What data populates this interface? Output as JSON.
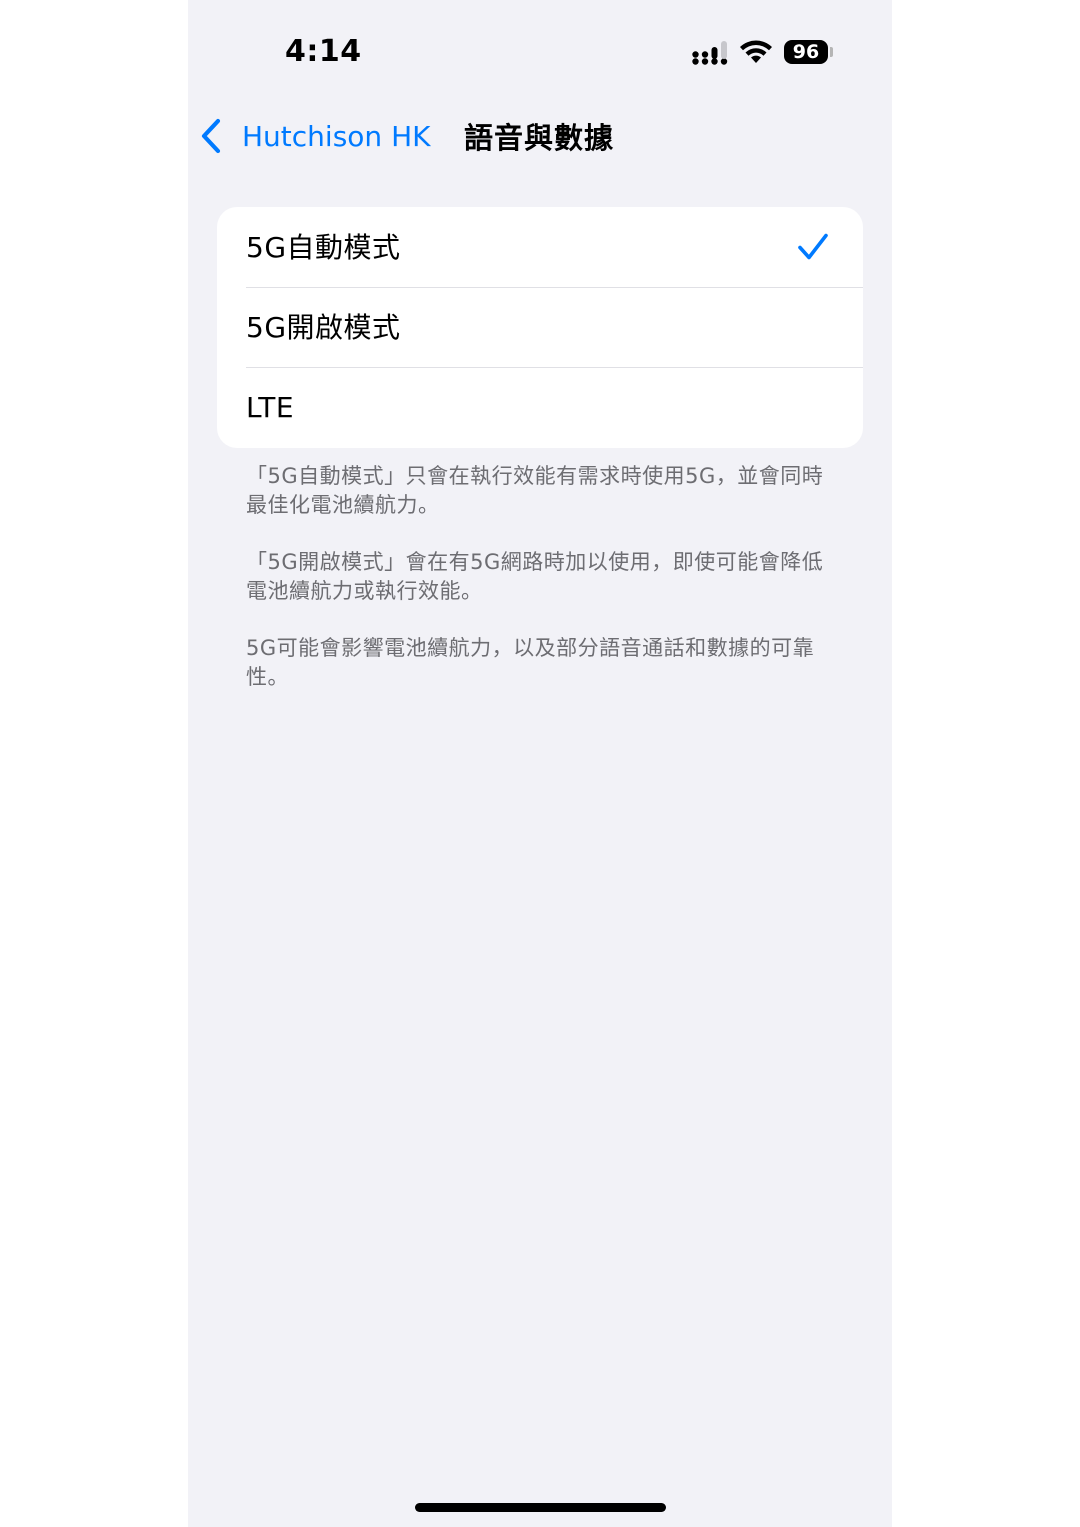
{
  "status_bar": {
    "time": "4:14",
    "battery_level": "96",
    "signal_icon": "cellular-signal-icon",
    "wifi_icon": "wifi-icon"
  },
  "nav": {
    "back_label": "Hutchison HK",
    "title": "語音與數據"
  },
  "options": [
    {
      "label": "5G自動模式",
      "selected": true
    },
    {
      "label": "5G開啟模式",
      "selected": false
    },
    {
      "label": "LTE",
      "selected": false
    }
  ],
  "footnotes": [
    "「5G自動模式」只會在執行效能有需求時使用5G，並會同時最佳化電池續航力。",
    "「5G開啟模式」會在有5G網路時加以使用，即使可能會降低電池續航力或執行效能。",
    "5G可能會影響電池續航力，以及部分語音通話和數據的可靠性。"
  ],
  "colors": {
    "accent": "#007aff",
    "background": "#f2f2f7",
    "footnote_text": "#6d6d72"
  }
}
